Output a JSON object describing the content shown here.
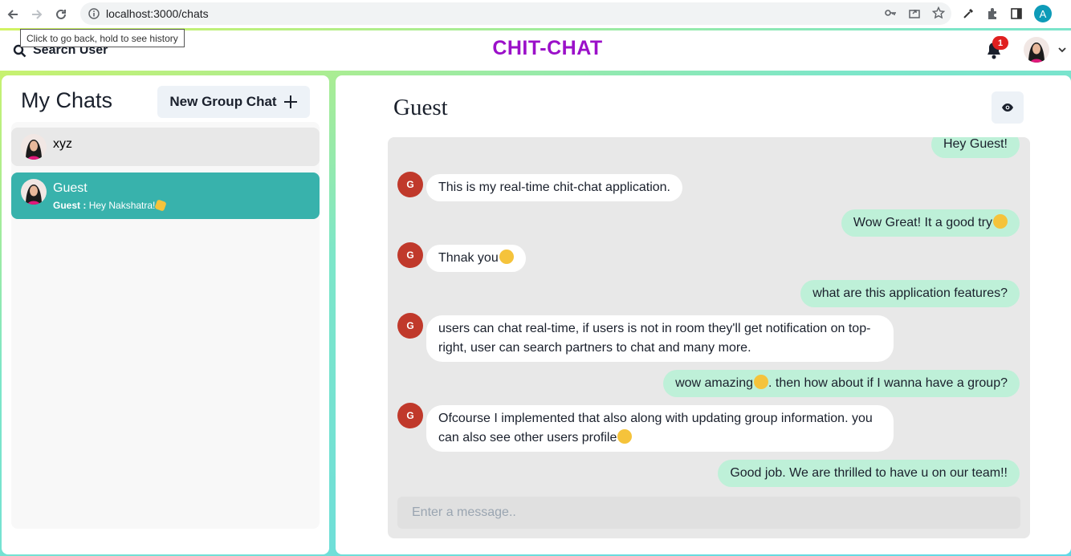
{
  "browser": {
    "url": "localhost:3000/chats",
    "profile_initial": "A",
    "tooltip": "Click to go back, hold to see history"
  },
  "header": {
    "search_label": "Search User",
    "brand": "CHIT-CHAT",
    "notification_count": "1"
  },
  "sidebar": {
    "title": "My Chats",
    "new_group_label": "New Group Chat",
    "chats": [
      {
        "name": "xyz"
      },
      {
        "name": "Guest",
        "preview_sender": "Guest :",
        "preview_text": "Hey Nakshatra!"
      }
    ]
  },
  "chat": {
    "title": "Guest",
    "input_placeholder": "Enter a message..",
    "sender_initial": "G",
    "messages": [
      {
        "from": "me",
        "text": "Hey Guest!"
      },
      {
        "from": "guest",
        "text": "This is my real-time chit-chat application."
      },
      {
        "from": "me",
        "text": "Wow Great! It a good try"
      },
      {
        "from": "guest",
        "text": "Thnak you"
      },
      {
        "from": "me",
        "text": "what are this application features?"
      },
      {
        "from": "guest",
        "text": "users can chat real-time, if users is not in room they'll get notification on top-right, user can search partners to chat and many more."
      },
      {
        "from": "me",
        "text_a": "wow amazing",
        "text_b": ". then how about if I wanna have a group?"
      },
      {
        "from": "guest",
        "text": "Ofcourse I implemented that also along with updating group information. you can also see other users profile"
      },
      {
        "from": "me",
        "text": "Good job. We are thrilled to have u on our team!!"
      }
    ]
  },
  "colors": {
    "brand": "#9b10c9",
    "active_chat": "#38b2ac",
    "sent_bubble": "#bef0d8",
    "guest_avatar": "#c0392b",
    "badge": "#e02020"
  }
}
